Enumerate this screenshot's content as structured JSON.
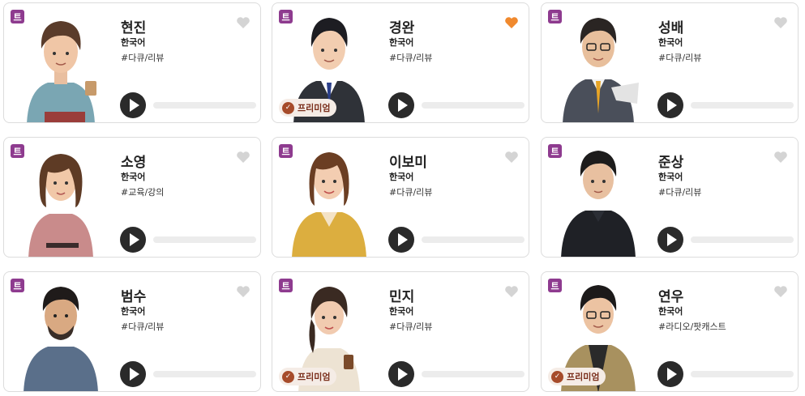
{
  "badge_label": "트",
  "premium_label": "프리미엄",
  "colors": {
    "badge": "#8e3b8f",
    "heart_off": "#d4d4d4",
    "heart_on": "#f0892e",
    "play": "#2a2a2a",
    "premium": "#a64b2a"
  },
  "voices": [
    {
      "name": "현진",
      "lang": "한국어",
      "tags": "#다큐/리뷰",
      "favorited": false,
      "premium": false,
      "progress": 0
    },
    {
      "name": "경완",
      "lang": "한국어",
      "tags": "#다큐/리뷰",
      "favorited": true,
      "premium": true,
      "progress": 0
    },
    {
      "name": "성배",
      "lang": "한국어",
      "tags": "#다큐/리뷰",
      "favorited": false,
      "premium": false,
      "progress": 0
    },
    {
      "name": "소영",
      "lang": "한국어",
      "tags": "#교육/강의",
      "favorited": false,
      "premium": false,
      "progress": 0
    },
    {
      "name": "이보미",
      "lang": "한국어",
      "tags": "#다큐/리뷰",
      "favorited": false,
      "premium": false,
      "progress": 0
    },
    {
      "name": "준상",
      "lang": "한국어",
      "tags": "#다큐/리뷰",
      "favorited": false,
      "premium": false,
      "progress": 0
    },
    {
      "name": "범수",
      "lang": "한국어",
      "tags": "#다큐/리뷰",
      "favorited": false,
      "premium": false,
      "progress": 0
    },
    {
      "name": "민지",
      "lang": "한국어",
      "tags": "#다큐/리뷰",
      "favorited": false,
      "premium": true,
      "progress": 0
    },
    {
      "name": "연우",
      "lang": "한국어",
      "tags": "#라디오/팟캐스트",
      "favorited": false,
      "premium": true,
      "progress": 0
    }
  ]
}
